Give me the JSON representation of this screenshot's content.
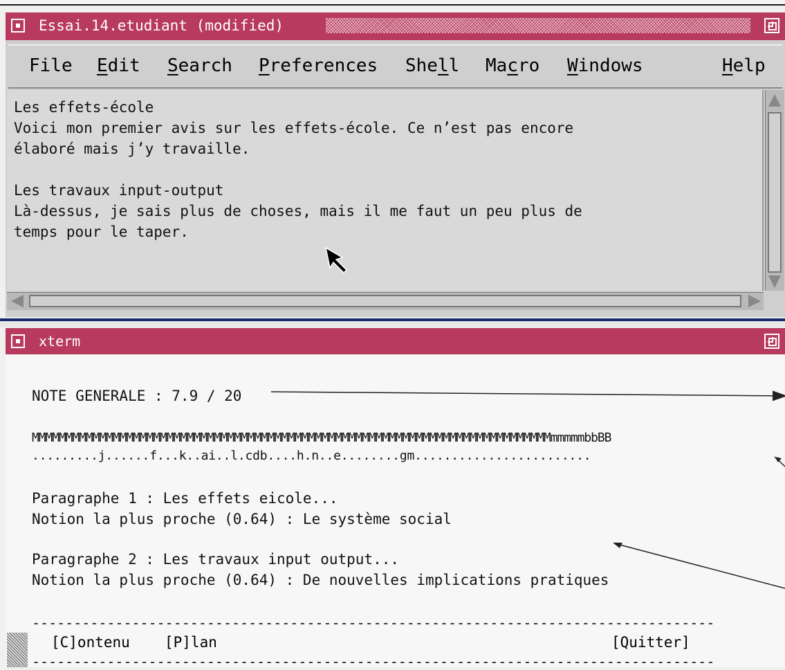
{
  "editor": {
    "title": "Essai.14.etudiant (modified)",
    "menu": [
      {
        "pre": "",
        "key": "F",
        "post": "ile",
        "underlined": false
      },
      {
        "pre": "",
        "key": "E",
        "post": "dit",
        "underlined": true
      },
      {
        "pre": "",
        "key": "S",
        "post": "earch",
        "underlined": true
      },
      {
        "pre": "",
        "key": "P",
        "post": "references",
        "underlined": true
      },
      {
        "pre": "She",
        "key": "l",
        "post": "l",
        "underlined": true
      },
      {
        "pre": "Ma",
        "key": "c",
        "post": "ro",
        "underlined": true
      },
      {
        "pre": "",
        "key": "W",
        "post": "indows",
        "underlined": true
      },
      {
        "pre": "",
        "key": "H",
        "post": "elp",
        "underlined": true
      }
    ],
    "text_lines": [
      "Les effets-école",
      "Voici mon premier avis sur les effets-école. Ce n’est pas encore",
      "élaboré mais j’y travaille.",
      "",
      "Les travaux input-output",
      "Là-dessus, je sais plus de choses, mais il me faut un peu plus de",
      "temps pour le taper."
    ]
  },
  "xterm": {
    "title": "xterm",
    "note": "NOTE GENERALE : 7.9 / 20",
    "scale_line": "MMMMMMMMMMMMMMMMMMMMMMMMMMMMMMMMMMMMMMMMMMMMMMMMMMMMMMMMMMMMMMMMMMMMMMMMMMMMMmmmmmbbBB",
    "marker_line": ".........j......f...k..ai..l.cdb....h.n..e........gm........................",
    "para1_title": "Paragraphe 1 : Les effets eicole...",
    "para1_notion": "Notion la plus proche (0.64) : Le système social",
    "para2_title": "Paragraphe 2 : Les travaux input output...",
    "para2_notion": "Notion la plus proche (0.64) : De nouvelles implications pratiques",
    "dashes": "-----------------------------------------------------------------------------------------------",
    "btn_contenu": "[C]ontenu",
    "btn_plan": "[P]lan",
    "btn_quitter": "[Quitter]"
  },
  "colors": {
    "titlebar": "#b83a5e",
    "separator": "#1a2a6e"
  },
  "icons": [
    "window-menu-icon",
    "maximize-icon",
    "mouse-pointer-icon",
    "scroll-arrow-icons"
  ]
}
